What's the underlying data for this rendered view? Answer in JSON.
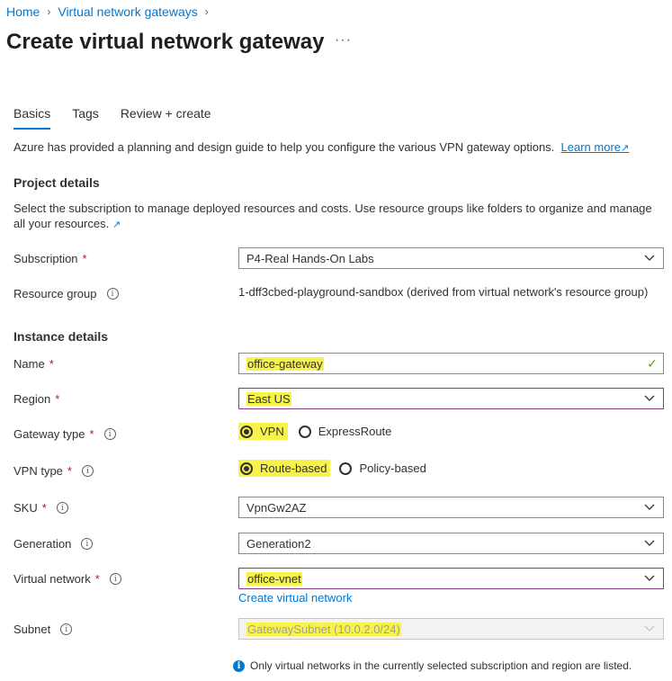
{
  "breadcrumb": {
    "home": "Home",
    "parent": "Virtual network gateways"
  },
  "page": {
    "title": "Create virtual network gateway",
    "more": "···"
  },
  "tabs": [
    {
      "label": "Basics"
    },
    {
      "label": "Tags"
    },
    {
      "label": "Review + create"
    }
  ],
  "intro": {
    "text": "Azure has provided a planning and design guide to help you configure the various VPN gateway options.",
    "link": "Learn more"
  },
  "project": {
    "heading": "Project details",
    "description": "Select the subscription to manage deployed resources and costs. Use resource groups like folders to organize and manage all your resources.",
    "subscription_label": "Subscription",
    "subscription_value": "P4-Real Hands-On Labs",
    "resource_group_label": "Resource group",
    "resource_group_value": "1-dff3cbed-playground-sandbox (derived from virtual network's resource group)"
  },
  "instance": {
    "heading": "Instance details",
    "name_label": "Name",
    "name_value": "office-gateway",
    "region_label": "Region",
    "region_value": "East US",
    "gateway_type_label": "Gateway type",
    "gateway_type_options": [
      "VPN",
      "ExpressRoute"
    ],
    "vpn_type_label": "VPN type",
    "vpn_type_options": [
      "Route-based",
      "Policy-based"
    ],
    "sku_label": "SKU",
    "sku_value": "VpnGw2AZ",
    "generation_label": "Generation",
    "generation_value": "Generation2",
    "vnet_label": "Virtual network",
    "vnet_value": "office-vnet",
    "create_vnet_link": "Create virtual network",
    "subnet_label": "Subnet",
    "subnet_value": "GatewaySubnet (10.0.2.0/24)",
    "note": "Only virtual networks in the currently selected subscription and region are listed."
  },
  "colors": {
    "accent": "#0078d4",
    "required": "#a4262c",
    "highlight": "#f7f34a",
    "valid": "#57a300"
  }
}
